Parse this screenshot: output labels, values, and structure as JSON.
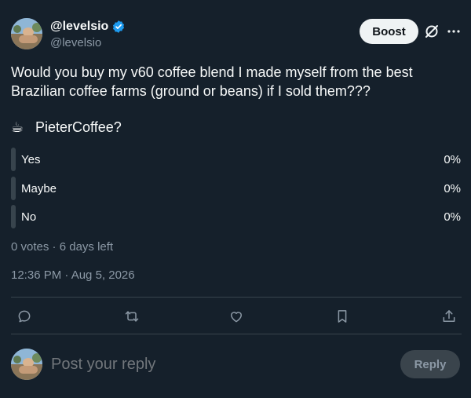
{
  "author": {
    "display_name": "@levelsio",
    "handle": "@levelsio",
    "verified": true
  },
  "header": {
    "boost_label": "Boost",
    "icons": [
      "avatar",
      "verified-badge-icon",
      "grok-slash-icon",
      "more-icon"
    ]
  },
  "tweet": {
    "text_line1": "Would you buy my v60 coffee blend I made myself from the best",
    "text_line2": "Brazilian coffee farms (ground or beans) if I sold them???",
    "poll_question_emoji": "☕",
    "poll_question": "PieterCoffee?"
  },
  "poll": {
    "options": [
      {
        "label": "Yes",
        "percent": "0%"
      },
      {
        "label": "Maybe",
        "percent": "0%"
      },
      {
        "label": "No",
        "percent": "0%"
      }
    ],
    "votes": "0 votes",
    "separator": "·",
    "time_left": "6 days left"
  },
  "timestamp": "12:36 PM · Aug 5, 2026",
  "actions": [
    "reply-icon",
    "retweet-icon",
    "like-icon",
    "bookmark-icon",
    "share-icon"
  ],
  "reply_box": {
    "placeholder": "Post your reply",
    "button_label": "Reply"
  },
  "colors": {
    "background": "#15202b",
    "text": "#f7f9f9",
    "muted": "#8b98a5",
    "verified": "#1d9bf0",
    "poll_bar": "#38444d"
  }
}
